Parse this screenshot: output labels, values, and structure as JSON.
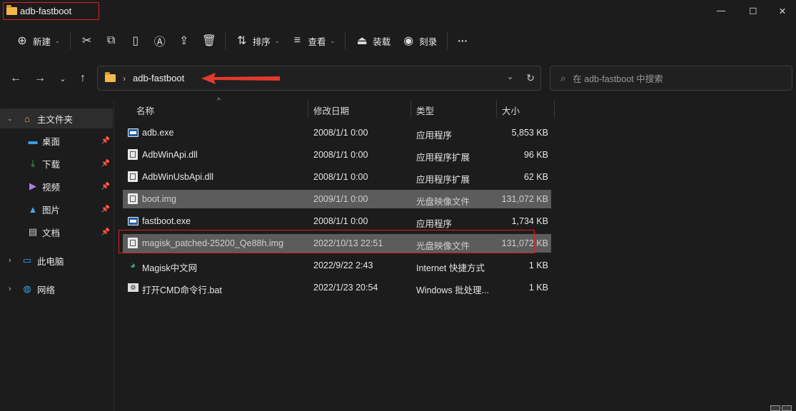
{
  "window": {
    "title": "adb-fastboot",
    "minimize_glyph": "—",
    "maximize_glyph": "☐",
    "close_glyph": "✕"
  },
  "toolbar": {
    "new_label": "新建",
    "sort_label": "排序",
    "view_label": "查看",
    "mount_label": "装载",
    "burn_label": "刻录",
    "more_label": "···"
  },
  "address": {
    "crumb": "adb-fastboot",
    "search_placeholder": "在 adb-fastboot 中搜索"
  },
  "sidebar": {
    "home": "主文件夹",
    "quick": [
      {
        "label": "桌面",
        "icon": "desktop-icon"
      },
      {
        "label": "下载",
        "icon": "download-icon"
      },
      {
        "label": "视频",
        "icon": "video-icon"
      },
      {
        "label": "图片",
        "icon": "pictures-icon"
      },
      {
        "label": "文档",
        "icon": "documents-icon"
      }
    ],
    "this_pc": "此电脑",
    "network": "网络"
  },
  "columns": {
    "name": "名称",
    "date": "修改日期",
    "type": "类型",
    "size": "大小"
  },
  "files": [
    {
      "name": "adb.exe",
      "date": "2008/1/1 0:00",
      "type": "应用程序",
      "size": "5,853 KB",
      "icon": "exe-icon"
    },
    {
      "name": "AdbWinApi.dll",
      "date": "2008/1/1 0:00",
      "type": "应用程序扩展",
      "size": "96 KB",
      "icon": "dll-icon"
    },
    {
      "name": "AdbWinUsbApi.dll",
      "date": "2008/1/1 0:00",
      "type": "应用程序扩展",
      "size": "62 KB",
      "icon": "dll-icon"
    },
    {
      "name": "boot.img",
      "date": "2009/1/1 0:00",
      "type": "光盘映像文件",
      "size": "131,072 KB",
      "icon": "disc-image-icon"
    },
    {
      "name": "fastboot.exe",
      "date": "2008/1/1 0:00",
      "type": "应用程序",
      "size": "1,734 KB",
      "icon": "exe-icon"
    },
    {
      "name": "magisk_patched-25200_Qe88h.img",
      "date": "2022/10/13 22:51",
      "type": "光盘映像文件",
      "size": "131,072 KB",
      "icon": "disc-image-icon"
    },
    {
      "name": "Magisk中文网",
      "date": "2022/9/22 2:43",
      "type": "Internet 快捷方式",
      "size": "1 KB",
      "icon": "edge-shortcut-icon"
    },
    {
      "name": "打开CMD命令行.bat",
      "date": "2022/1/23 20:54",
      "type": "Windows 批处理...",
      "size": "1 KB",
      "icon": "bat-icon"
    }
  ]
}
